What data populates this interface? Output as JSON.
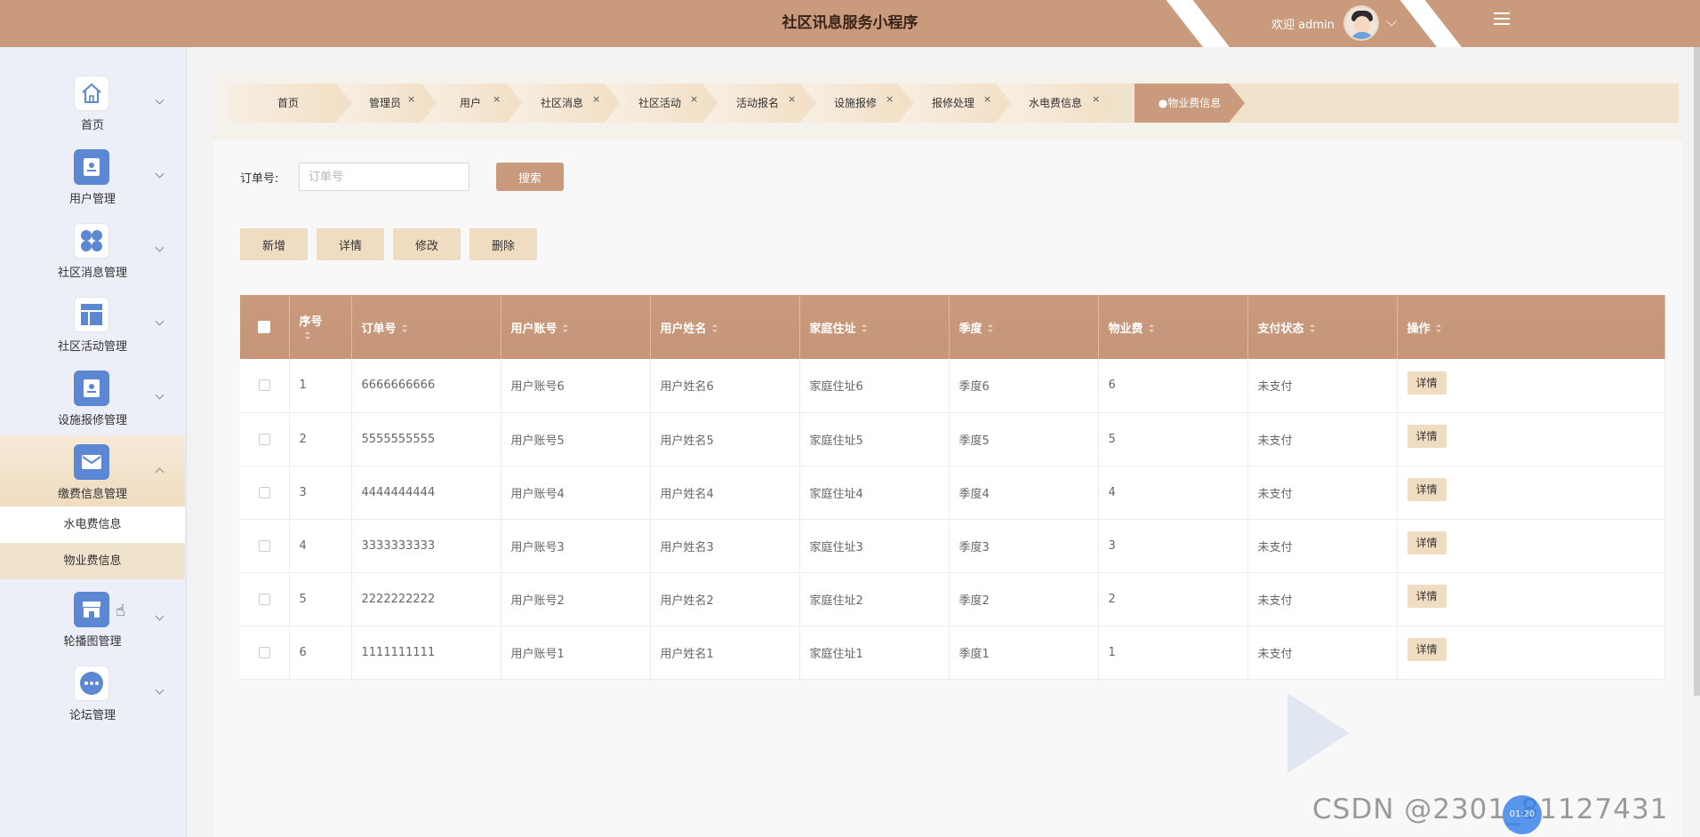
{
  "header": {
    "title": "社区讯息服务小程序",
    "welcome": "欢迎 admin"
  },
  "sidebar": {
    "items": [
      {
        "label": "首页",
        "icon": "home-icon"
      },
      {
        "label": "用户管理",
        "icon": "user-card-icon"
      },
      {
        "label": "社区消息管理",
        "icon": "grid-dots-icon"
      },
      {
        "label": "社区活动管理",
        "icon": "layout-icon"
      },
      {
        "label": "设施报修管理",
        "icon": "repair-card-icon"
      },
      {
        "label": "缴费信息管理",
        "icon": "envelope-icon"
      },
      {
        "label": "轮播图管理",
        "icon": "store-icon"
      },
      {
        "label": "论坛管理",
        "icon": "forum-icon"
      }
    ],
    "sub_items": [
      "水电费信息",
      "物业费信息"
    ]
  },
  "breadcrumbs": [
    {
      "label": "首页"
    },
    {
      "label": "管理员",
      "close": "×"
    },
    {
      "label": "用户",
      "close": "×"
    },
    {
      "label": "社区消息",
      "close": "×"
    },
    {
      "label": "社区活动",
      "close": "×"
    },
    {
      "label": "活动报名",
      "close": "×"
    },
    {
      "label": "设施报修",
      "close": "×"
    },
    {
      "label": "报修处理",
      "close": "×"
    },
    {
      "label": "水电费信息",
      "close": "×"
    },
    {
      "label": "●物业费信息"
    }
  ],
  "search": {
    "label": "订单号:",
    "placeholder": "订单号",
    "button": "搜索"
  },
  "actions": {
    "add": "新增",
    "detail": "详情",
    "edit": "修改",
    "delete": "删除"
  },
  "table": {
    "columns": [
      "序号",
      "订单号",
      "用户账号",
      "用户姓名",
      "家庭住址",
      "季度",
      "物业费",
      "支付状态",
      "操作"
    ],
    "rows": [
      {
        "no": "1",
        "order": "6666666666",
        "account": "用户账号6",
        "name": "用户姓名6",
        "address": "家庭住址6",
        "quarter": "季度6",
        "fee": "6",
        "status": "未支付",
        "op": "详情"
      },
      {
        "no": "2",
        "order": "5555555555",
        "account": "用户账号5",
        "name": "用户姓名5",
        "address": "家庭住址5",
        "quarter": "季度5",
        "fee": "5",
        "status": "未支付",
        "op": "详情"
      },
      {
        "no": "3",
        "order": "4444444444",
        "account": "用户账号4",
        "name": "用户姓名4",
        "address": "家庭住址4",
        "quarter": "季度4",
        "fee": "4",
        "status": "未支付",
        "op": "详情"
      },
      {
        "no": "4",
        "order": "3333333333",
        "account": "用户账号3",
        "name": "用户姓名3",
        "address": "家庭住址3",
        "quarter": "季度3",
        "fee": "3",
        "status": "未支付",
        "op": "详情"
      },
      {
        "no": "5",
        "order": "2222222222",
        "account": "用户账号2",
        "name": "用户姓名2",
        "address": "家庭住址2",
        "quarter": "季度2",
        "fee": "2",
        "status": "未支付",
        "op": "详情"
      },
      {
        "no": "6",
        "order": "1111111111",
        "account": "用户账号1",
        "name": "用户姓名1",
        "address": "家庭住址1",
        "quarter": "季度1",
        "fee": "1",
        "status": "未支付",
        "op": "详情"
      }
    ]
  },
  "watermark": {
    "csdn": "CSDN @2301_81127431",
    "recorder": "01:20"
  },
  "colors": {
    "brand": "#c99a7c",
    "button_light": "#f0dcc1",
    "sidebar_bg": "#eceef8",
    "icon_blue": "#5b87d3"
  }
}
